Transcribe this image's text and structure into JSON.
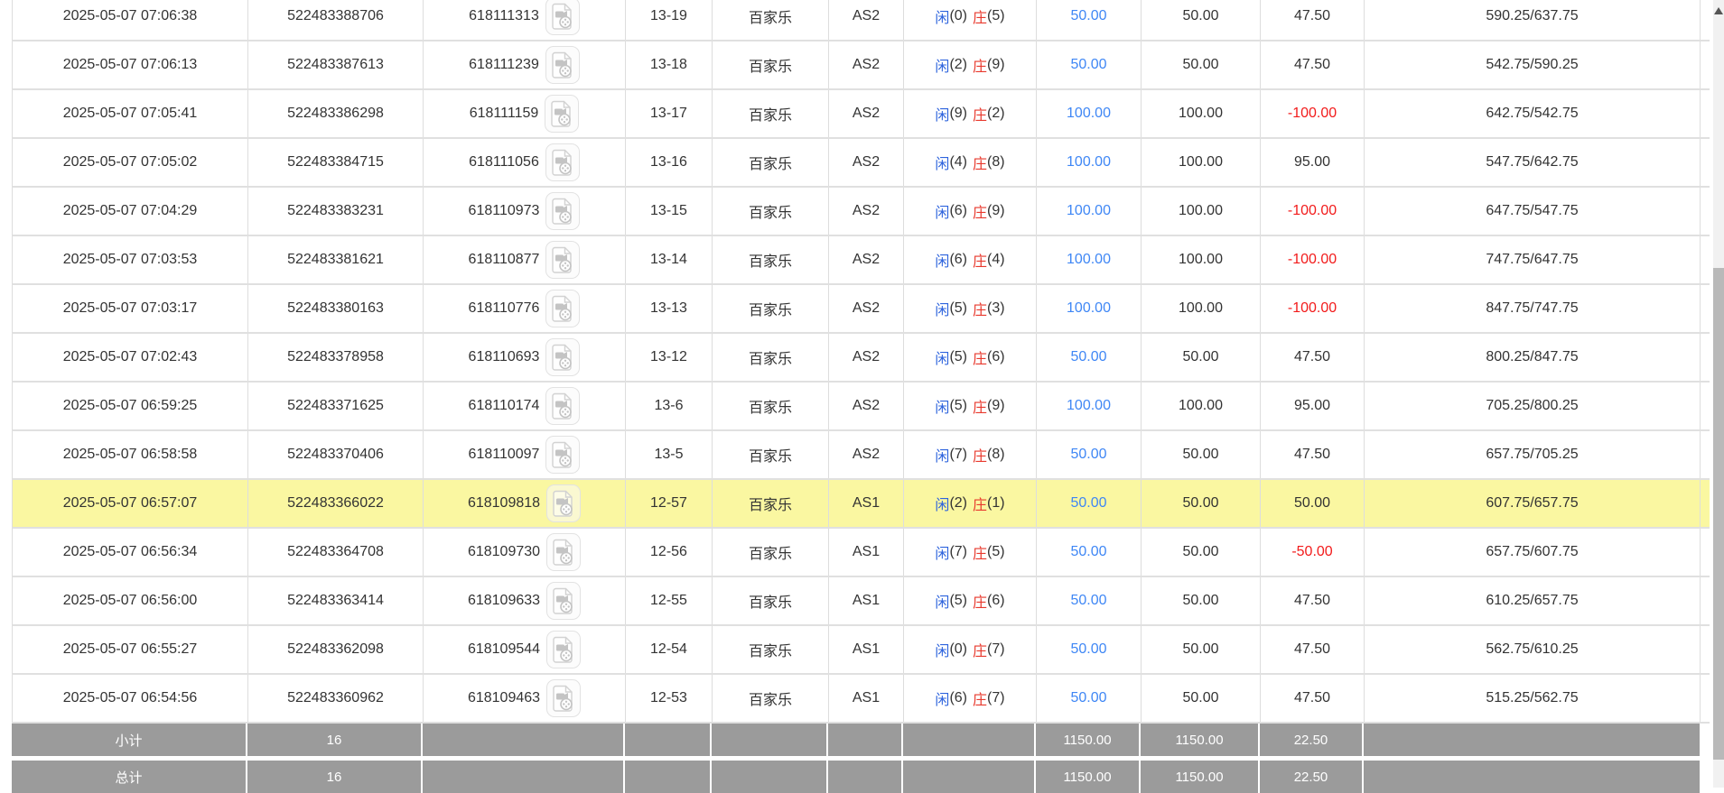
{
  "icons": {
    "game_video": "video-replay-icon",
    "scroll_up": "scroll-up-arrow-icon"
  },
  "colors": {
    "highlight_row": "#faf7a1",
    "footer_bg": "#9b9b9b",
    "bet_blue": "#3f87f5",
    "player_blue": "#2d63dd",
    "banker_red": "#e8392d",
    "negative_red": "#f21b1b",
    "grid_line": "#dddddd",
    "scroll_thumb": "#b9b9b9",
    "scroll_track": "#f1f1f1"
  },
  "table": {
    "rows": [
      {
        "time": "2025-05-07 07:06:38",
        "order_no": "522483388706",
        "game_no": "618111313",
        "round": "13-19",
        "game_type": "百家乐",
        "table_name": "AS2",
        "result": {
          "p": "闲",
          "pn": "(0)",
          "b": "庄",
          "bn": "(5)"
        },
        "bet": "50.00",
        "valid": "50.00",
        "win_loss": "47.50",
        "balance": "590.25/637.75",
        "highlighted": false
      },
      {
        "time": "2025-05-07 07:06:13",
        "order_no": "522483387613",
        "game_no": "618111239",
        "round": "13-18",
        "game_type": "百家乐",
        "table_name": "AS2",
        "result": {
          "p": "闲",
          "pn": "(2)",
          "b": "庄",
          "bn": "(9)"
        },
        "bet": "50.00",
        "valid": "50.00",
        "win_loss": "47.50",
        "balance": "542.75/590.25",
        "highlighted": false
      },
      {
        "time": "2025-05-07 07:05:41",
        "order_no": "522483386298",
        "game_no": "618111159",
        "round": "13-17",
        "game_type": "百家乐",
        "table_name": "AS2",
        "result": {
          "p": "闲",
          "pn": "(9)",
          "b": "庄",
          "bn": "(2)"
        },
        "bet": "100.00",
        "valid": "100.00",
        "win_loss": "-100.00",
        "balance": "642.75/542.75",
        "highlighted": false
      },
      {
        "time": "2025-05-07 07:05:02",
        "order_no": "522483384715",
        "game_no": "618111056",
        "round": "13-16",
        "game_type": "百家乐",
        "table_name": "AS2",
        "result": {
          "p": "闲",
          "pn": "(4)",
          "b": "庄",
          "bn": "(8)"
        },
        "bet": "100.00",
        "valid": "100.00",
        "win_loss": "95.00",
        "balance": "547.75/642.75",
        "highlighted": false
      },
      {
        "time": "2025-05-07 07:04:29",
        "order_no": "522483383231",
        "game_no": "618110973",
        "round": "13-15",
        "game_type": "百家乐",
        "table_name": "AS2",
        "result": {
          "p": "闲",
          "pn": "(6)",
          "b": "庄",
          "bn": "(9)"
        },
        "bet": "100.00",
        "valid": "100.00",
        "win_loss": "-100.00",
        "balance": "647.75/547.75",
        "highlighted": false
      },
      {
        "time": "2025-05-07 07:03:53",
        "order_no": "522483381621",
        "game_no": "618110877",
        "round": "13-14",
        "game_type": "百家乐",
        "table_name": "AS2",
        "result": {
          "p": "闲",
          "pn": "(6)",
          "b": "庄",
          "bn": "(4)"
        },
        "bet": "100.00",
        "valid": "100.00",
        "win_loss": "-100.00",
        "balance": "747.75/647.75",
        "highlighted": false
      },
      {
        "time": "2025-05-07 07:03:17",
        "order_no": "522483380163",
        "game_no": "618110776",
        "round": "13-13",
        "game_type": "百家乐",
        "table_name": "AS2",
        "result": {
          "p": "闲",
          "pn": "(5)",
          "b": "庄",
          "bn": "(3)"
        },
        "bet": "100.00",
        "valid": "100.00",
        "win_loss": "-100.00",
        "balance": "847.75/747.75",
        "highlighted": false
      },
      {
        "time": "2025-05-07 07:02:43",
        "order_no": "522483378958",
        "game_no": "618110693",
        "round": "13-12",
        "game_type": "百家乐",
        "table_name": "AS2",
        "result": {
          "p": "闲",
          "pn": "(5)",
          "b": "庄",
          "bn": "(6)"
        },
        "bet": "50.00",
        "valid": "50.00",
        "win_loss": "47.50",
        "balance": "800.25/847.75",
        "highlighted": false
      },
      {
        "time": "2025-05-07 06:59:25",
        "order_no": "522483371625",
        "game_no": "618110174",
        "round": "13-6",
        "game_type": "百家乐",
        "table_name": "AS2",
        "result": {
          "p": "闲",
          "pn": "(5)",
          "b": "庄",
          "bn": "(9)"
        },
        "bet": "100.00",
        "valid": "100.00",
        "win_loss": "95.00",
        "balance": "705.25/800.25",
        "highlighted": false
      },
      {
        "time": "2025-05-07 06:58:58",
        "order_no": "522483370406",
        "game_no": "618110097",
        "round": "13-5",
        "game_type": "百家乐",
        "table_name": "AS2",
        "result": {
          "p": "闲",
          "pn": "(7)",
          "b": "庄",
          "bn": "(8)"
        },
        "bet": "50.00",
        "valid": "50.00",
        "win_loss": "47.50",
        "balance": "657.75/705.25",
        "highlighted": false
      },
      {
        "time": "2025-05-07 06:57:07",
        "order_no": "522483366022",
        "game_no": "618109818",
        "round": "12-57",
        "game_type": "百家乐",
        "table_name": "AS1",
        "result": {
          "p": "闲",
          "pn": "(2)",
          "b": "庄",
          "bn": "(1)"
        },
        "bet": "50.00",
        "valid": "50.00",
        "win_loss": "50.00",
        "balance": "607.75/657.75",
        "highlighted": true
      },
      {
        "time": "2025-05-07 06:56:34",
        "order_no": "522483364708",
        "game_no": "618109730",
        "round": "12-56",
        "game_type": "百家乐",
        "table_name": "AS1",
        "result": {
          "p": "闲",
          "pn": "(7)",
          "b": "庄",
          "bn": "(5)"
        },
        "bet": "50.00",
        "valid": "50.00",
        "win_loss": "-50.00",
        "balance": "657.75/607.75",
        "highlighted": false
      },
      {
        "time": "2025-05-07 06:56:00",
        "order_no": "522483363414",
        "game_no": "618109633",
        "round": "12-55",
        "game_type": "百家乐",
        "table_name": "AS1",
        "result": {
          "p": "闲",
          "pn": "(5)",
          "b": "庄",
          "bn": "(6)"
        },
        "bet": "50.00",
        "valid": "50.00",
        "win_loss": "47.50",
        "balance": "610.25/657.75",
        "highlighted": false
      },
      {
        "time": "2025-05-07 06:55:27",
        "order_no": "522483362098",
        "game_no": "618109544",
        "round": "12-54",
        "game_type": "百家乐",
        "table_name": "AS1",
        "result": {
          "p": "闲",
          "pn": "(0)",
          "b": "庄",
          "bn": "(7)"
        },
        "bet": "50.00",
        "valid": "50.00",
        "win_loss": "47.50",
        "balance": "562.75/610.25",
        "highlighted": false
      },
      {
        "time": "2025-05-07 06:54:56",
        "order_no": "522483360962",
        "game_no": "618109463",
        "round": "12-53",
        "game_type": "百家乐",
        "table_name": "AS1",
        "result": {
          "p": "闲",
          "pn": "(6)",
          "b": "庄",
          "bn": "(7)"
        },
        "bet": "50.00",
        "valid": "50.00",
        "win_loss": "47.50",
        "balance": "515.25/562.75",
        "highlighted": false
      }
    ],
    "footer_rows": [
      {
        "label": "小计",
        "count": "16",
        "bet": "1150.00",
        "valid": "1150.00",
        "win_loss": "22.50"
      },
      {
        "label": "总计",
        "count": "16",
        "bet": "1150.00",
        "valid": "1150.00",
        "win_loss": "22.50"
      }
    ]
  }
}
